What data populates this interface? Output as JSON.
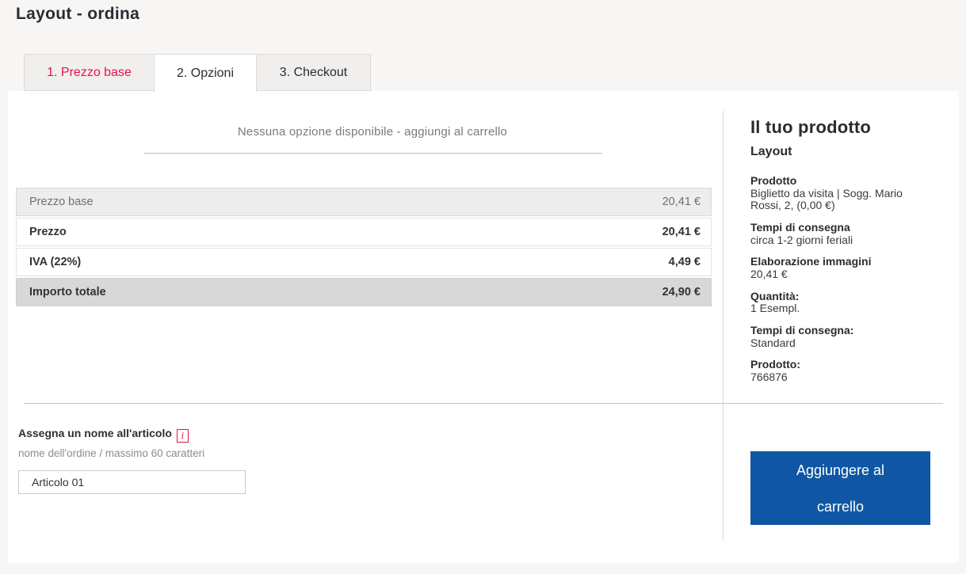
{
  "page": {
    "title": "Layout - ordina"
  },
  "tabs": [
    {
      "label": "1. Prezzo base",
      "active": false
    },
    {
      "label": "2. Opzioni",
      "active": true
    },
    {
      "label": "3. Checkout",
      "active": false
    }
  ],
  "options_message": "Nessuna opzione disponibile - aggiungi al carrello",
  "price_table": {
    "rows": [
      {
        "label": "Prezzo base",
        "value": "20,41 €",
        "style": "muted"
      },
      {
        "label": "Prezzo",
        "value": "20,41 €",
        "style": "bold"
      },
      {
        "label": "IVA (22%)",
        "value": "4,49 €",
        "style": "bold"
      },
      {
        "label": "Importo totale",
        "value": "24,90 €",
        "style": "total"
      }
    ]
  },
  "article_name": {
    "label": "Assegna un nome all'articolo",
    "info_icon": "i",
    "hint": "nome dell'ordine / massimo 60 caratteri",
    "value": "Articolo 01"
  },
  "product_summary": {
    "heading": "Il tuo prodotto",
    "subheading": "Layout",
    "details": [
      {
        "label": "Prodotto",
        "value": "Biglietto da visita | Sogg. Mario Rossi, 2, (0,00 €)"
      },
      {
        "label": "Tempi di consegna",
        "value": "circa 1-2 giorni feriali"
      },
      {
        "label": "Elaborazione immagini",
        "value": "20,41 €"
      },
      {
        "label": "Quantità:",
        "value": "1 Esempl."
      },
      {
        "label": "Tempi di consegna:",
        "value": "Standard"
      },
      {
        "label": "Prodotto:",
        "value": "766876"
      }
    ]
  },
  "cart_button": {
    "label": "Aggiungere al carrello"
  },
  "colors": {
    "accent_red": "#e5124a",
    "brand_blue": "#0f57a4",
    "page_bg": "#f7f6f4",
    "row_muted_bg": "#ededed",
    "row_total_bg": "#d8d8d8"
  }
}
